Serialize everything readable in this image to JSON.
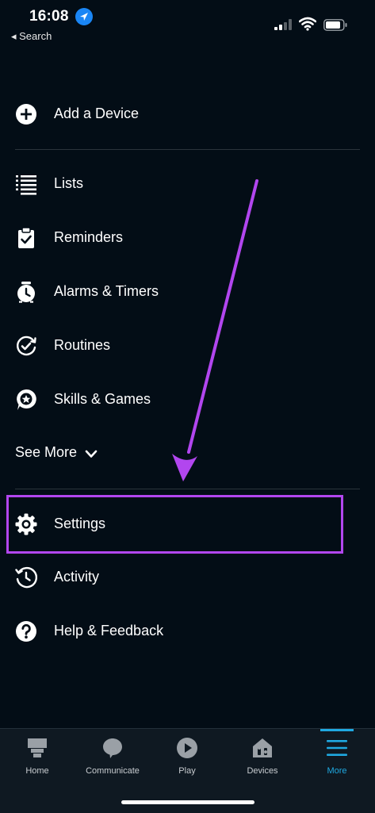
{
  "status_bar": {
    "time": "16:08",
    "back_label": "◂ Search"
  },
  "menu": {
    "add_device": "Add a Device",
    "items": [
      {
        "label": "Lists",
        "icon": "list-icon"
      },
      {
        "label": "Reminders",
        "icon": "clipboard-check-icon"
      },
      {
        "label": "Alarms & Timers",
        "icon": "alarm-clock-icon"
      },
      {
        "label": "Routines",
        "icon": "routines-icon"
      },
      {
        "label": "Skills & Games",
        "icon": "skills-icon"
      }
    ],
    "see_more": "See More",
    "settings": "Settings",
    "activity": "Activity",
    "help": "Help & Feedback"
  },
  "annotation": {
    "highlight_color": "#b246ef"
  },
  "tabs": [
    {
      "label": "Home",
      "icon": "home-icon",
      "active": false
    },
    {
      "label": "Communicate",
      "icon": "chat-bubble-icon",
      "active": false
    },
    {
      "label": "Play",
      "icon": "play-icon",
      "active": false
    },
    {
      "label": "Devices",
      "icon": "devices-icon",
      "active": false
    },
    {
      "label": "More",
      "icon": "menu-icon",
      "active": true
    }
  ],
  "colors": {
    "background": "#030d16",
    "accent": "#1fa9e1",
    "tabbar": "#0f1922"
  }
}
